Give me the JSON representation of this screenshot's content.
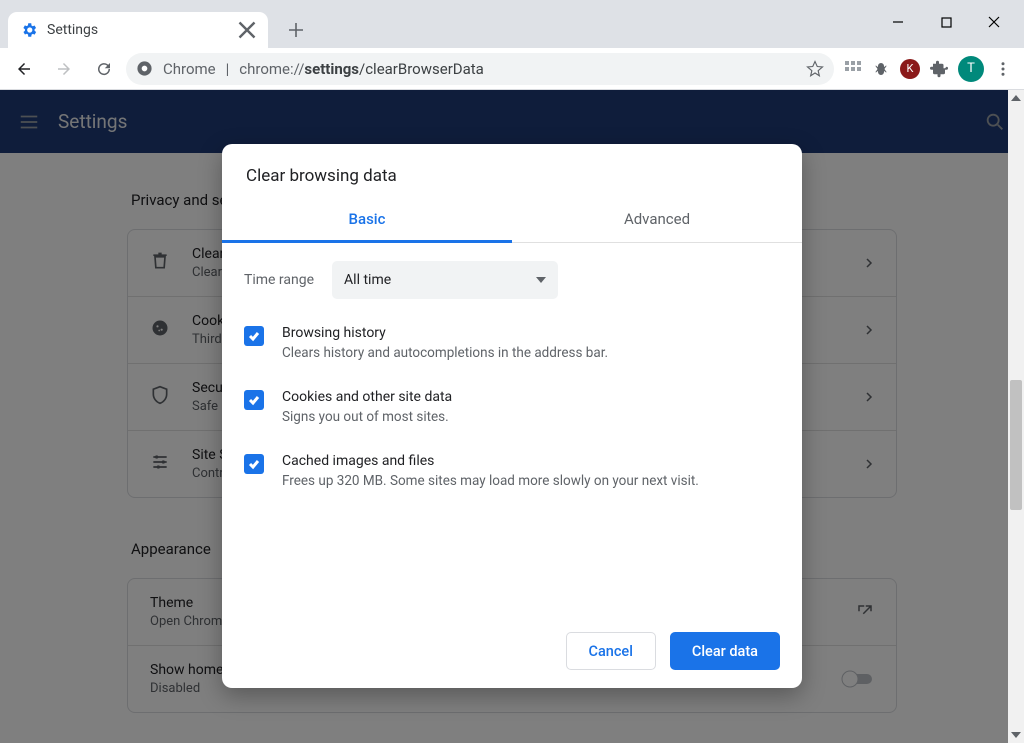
{
  "window": {
    "tab_title": "Settings"
  },
  "address": {
    "origin_label": "Chrome",
    "url_host": "chrome://",
    "url_bold": "settings",
    "url_path": "/clearBrowserData"
  },
  "app_header": {
    "title": "Settings"
  },
  "sections": {
    "privacy": {
      "heading": "Privacy and security",
      "rows": [
        {
          "title": "Clear browsing data",
          "sub": "Clear history, cookies, cache, and more"
        },
        {
          "title": "Cookies and other site data",
          "sub": "Third-party cookies are blocked in Incognito mode"
        },
        {
          "title": "Security",
          "sub": "Safe Browsing (protection from dangerous sites) and other security settings"
        },
        {
          "title": "Site Settings",
          "sub": "Controls what information sites can use and show"
        }
      ]
    },
    "appearance": {
      "heading": "Appearance",
      "rows": [
        {
          "title": "Theme",
          "sub": "Open Chrome Web Store"
        },
        {
          "title": "Show home button",
          "sub": "Disabled"
        }
      ]
    }
  },
  "dialog": {
    "title": "Clear browsing data",
    "tabs": {
      "basic": "Basic",
      "advanced": "Advanced"
    },
    "time_label": "Time range",
    "time_value": "All time",
    "options": [
      {
        "title": "Browsing history",
        "sub": "Clears history and autocompletions in the address bar."
      },
      {
        "title": "Cookies and other site data",
        "sub": "Signs you out of most sites."
      },
      {
        "title": "Cached images and files",
        "sub": "Frees up 320 MB. Some sites may load more slowly on your next visit."
      }
    ],
    "cancel": "Cancel",
    "clear": "Clear data"
  },
  "avatar_initial": "T"
}
